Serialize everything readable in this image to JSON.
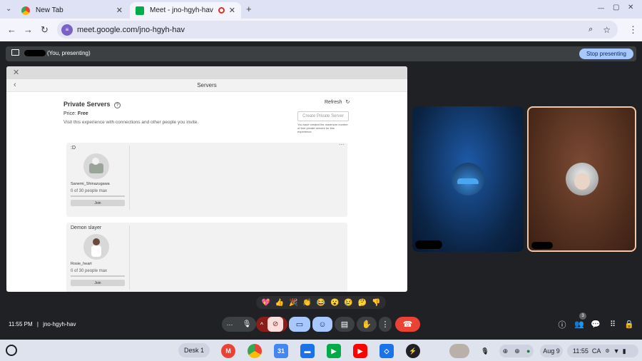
{
  "browser": {
    "tabs": [
      {
        "label": "New Tab",
        "close": "✕"
      },
      {
        "label": "Meet - jno-hgyh-hav",
        "close": "✕"
      }
    ],
    "new_tab": "+",
    "url": "meet.google.com/jno-hgyh-hav",
    "window_controls": {
      "minimize": "—",
      "maximize": "▢",
      "close": "✕"
    }
  },
  "presenting_bar": {
    "label": "(You, presenting)",
    "stop_button": "Stop presenting"
  },
  "shared_screen": {
    "header_title": "Servers",
    "section_title": "Private Servers",
    "refresh_label": "Refresh",
    "price_label": "Price:",
    "price_value": "Free",
    "description": "Visit this experience with connections and other people you invite.",
    "create_button": "Create Private Server",
    "create_note": "You have created the maximum number of free private servers for this experience.",
    "servers": [
      {
        "name": ":D",
        "owner": "Sanemi_Shinazugawa",
        "capacity": "0 of 30 people max",
        "join": "Join"
      },
      {
        "name": "Demon slayer",
        "owner": "Rosie_heart",
        "capacity": "0 of 30 people max",
        "join": "Join"
      }
    ]
  },
  "reactions": [
    "💖",
    "👍",
    "🎉",
    "👏",
    "😂",
    "😮",
    "😢",
    "🤔",
    "👎"
  ],
  "meeting": {
    "time": "11:55 PM",
    "separator": "|",
    "code": "jno-hgyh-hav",
    "participants_badge": "3"
  },
  "shelf": {
    "desk": "Desk 1",
    "date": "Aug 9",
    "time": "11:55",
    "region": "CA"
  },
  "colors": {
    "meet_bg": "#202124",
    "stop_button_bg": "#a8c7fa",
    "end_call": "#ea4335",
    "mic_off": "#8c1d18"
  }
}
